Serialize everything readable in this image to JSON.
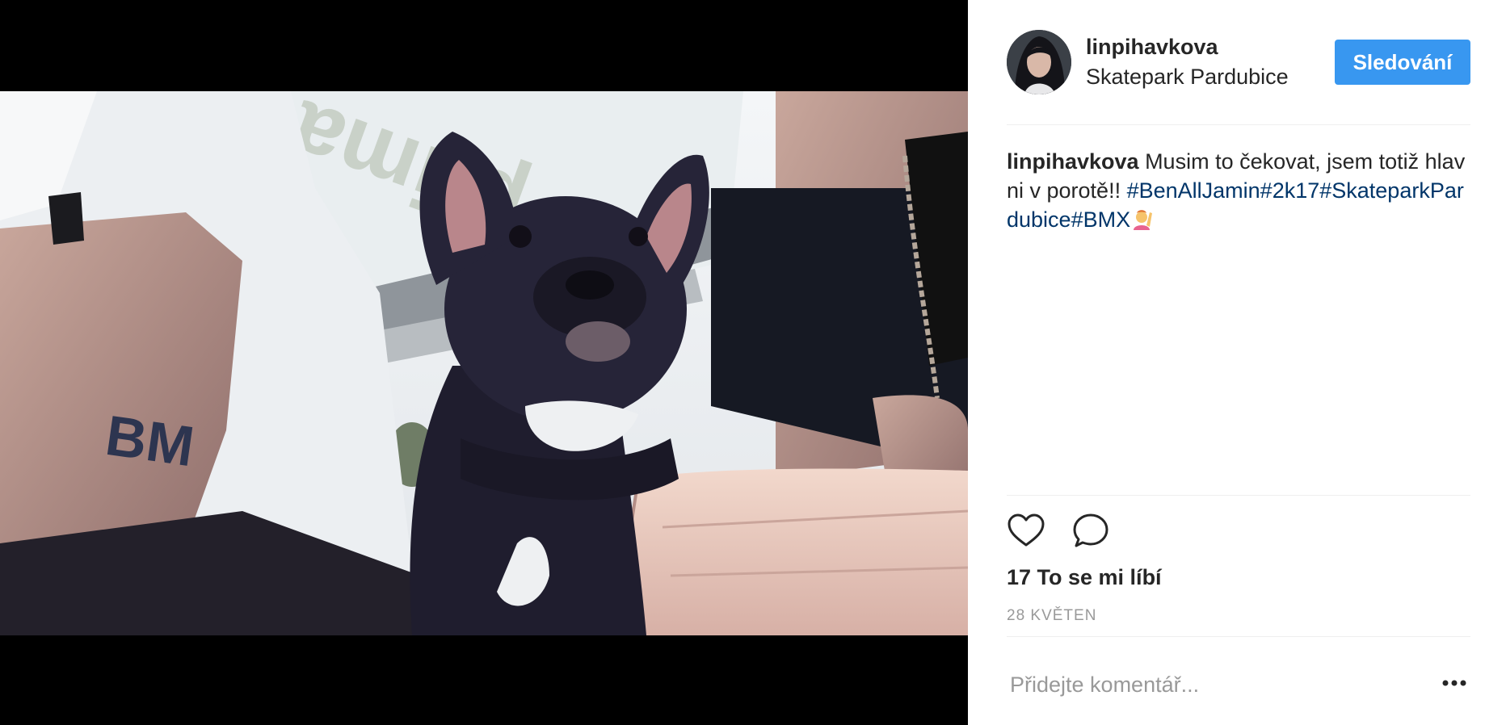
{
  "post": {
    "username": "linpihavkova",
    "location": "Skatepark Pardubice",
    "follow_label": "Sledování",
    "caption_user": "linpihavkova",
    "caption_text": " Musim to čekovat, jsem totiž hlavni v porotě!!",
    "caption_hashtags": "#BenAllJamin#2k17#SkateparkPardubice#BMX",
    "likes": "17 To se mi líbí",
    "date": "28 KVĚTEN",
    "comment_placeholder": "Přidejte komentář..."
  },
  "icons": {
    "like": "heart-icon",
    "comment": "speech-bubble-icon",
    "more": "more-options-icon",
    "emoji": "person-raising-hand-emoji"
  },
  "colors": {
    "follow_button": "#3897f0",
    "hashtag": "#003569",
    "text": "#262626",
    "muted": "#999999"
  }
}
